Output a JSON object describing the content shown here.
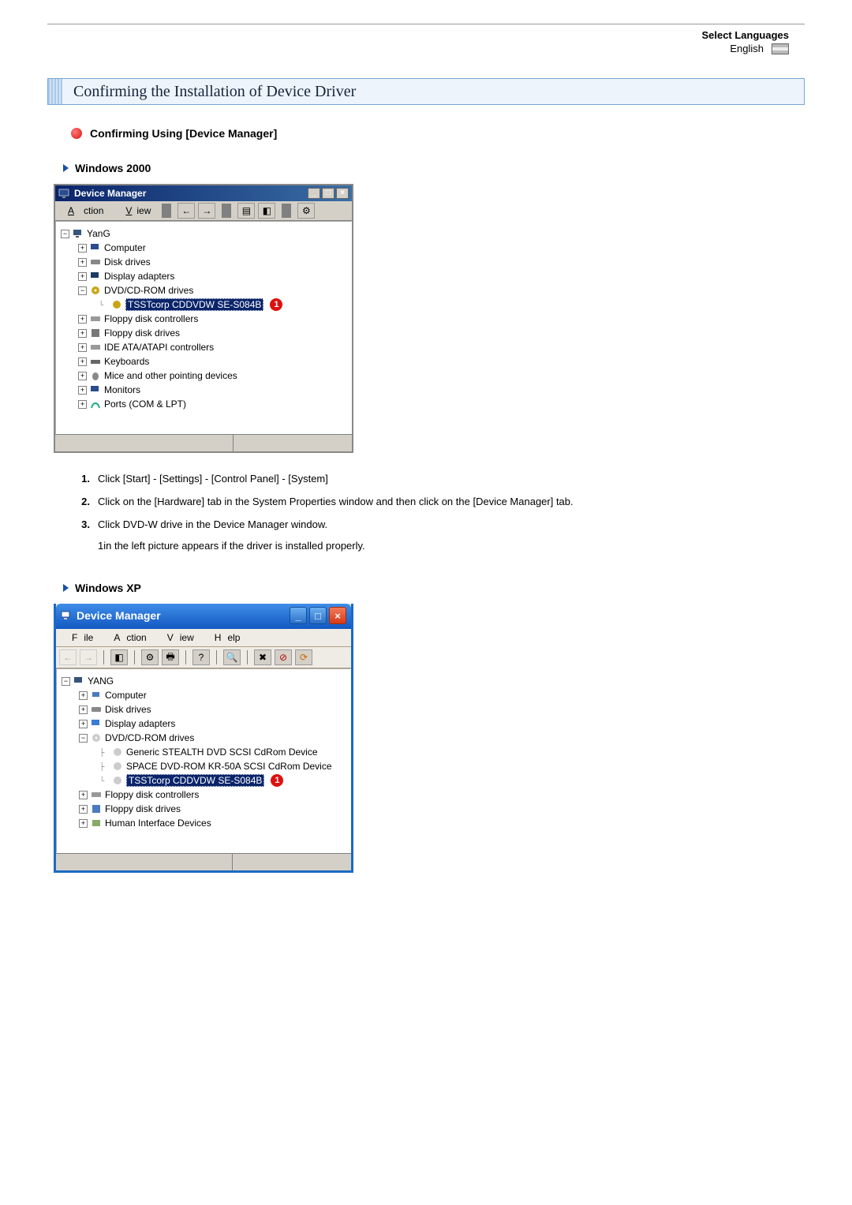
{
  "language_selector": {
    "label": "Select Languages",
    "value": "English"
  },
  "title_bar": "Confirming the Installation of Device Driver",
  "subheading": "Confirming Using [Device Manager]",
  "sections": {
    "win2000": {
      "heading": "Windows 2000",
      "window_title": "Device Manager",
      "menu": [
        "Action",
        "View"
      ],
      "toolbar_icon_names": [
        "back-icon",
        "forward-icon",
        "view-icon",
        "show-hide-icon",
        "properties-icon"
      ],
      "tree": {
        "root": "YanG",
        "nodes": [
          "Computer",
          "Disk drives",
          "Display adapters",
          "DVD/CD-ROM drives",
          "Floppy disk controllers",
          "Floppy disk drives",
          "IDE ATA/ATAPI controllers",
          "Keyboards",
          "Mice and other pointing devices",
          "Monitors",
          "Ports (COM & LPT)"
        ],
        "highlighted_device": "TSSTcorp CDDVDW SE-S084B",
        "callout": "1"
      },
      "steps": [
        "Click [Start] - [Settings] - [Control Panel] - [System]",
        "Click on the [Hardware] tab in the System Properties window and then click on the [Device Manager] tab.",
        "Click DVD-W drive in the Device Manager window."
      ],
      "step3_note": "1in the left picture appears if the driver is installed properly."
    },
    "winxp": {
      "heading": "Windows XP",
      "window_title": "Device Manager",
      "menu": [
        "File",
        "Action",
        "View",
        "Help"
      ],
      "toolbar_icon_names": [
        "back-icon",
        "forward-icon",
        "up-icon",
        "properties-icon",
        "print-icon",
        "help-icon",
        "scan-icon",
        "uninstall-icon",
        "disable-icon",
        "update-icon"
      ],
      "tree": {
        "root": "YANG",
        "nodes": [
          "Computer",
          "Disk drives",
          "Display adapters",
          "DVD/CD-ROM drives",
          "Floppy disk controllers",
          "Floppy disk drives",
          "Human Interface Devices"
        ],
        "dvd_children": [
          "Generic STEALTH DVD SCSI CdRom Device",
          "SPACE DVD-ROM KR-50A SCSI CdRom Device"
        ],
        "highlighted_device": "TSSTcorp CDDVDW SE-S084B",
        "callout": "1"
      }
    }
  }
}
